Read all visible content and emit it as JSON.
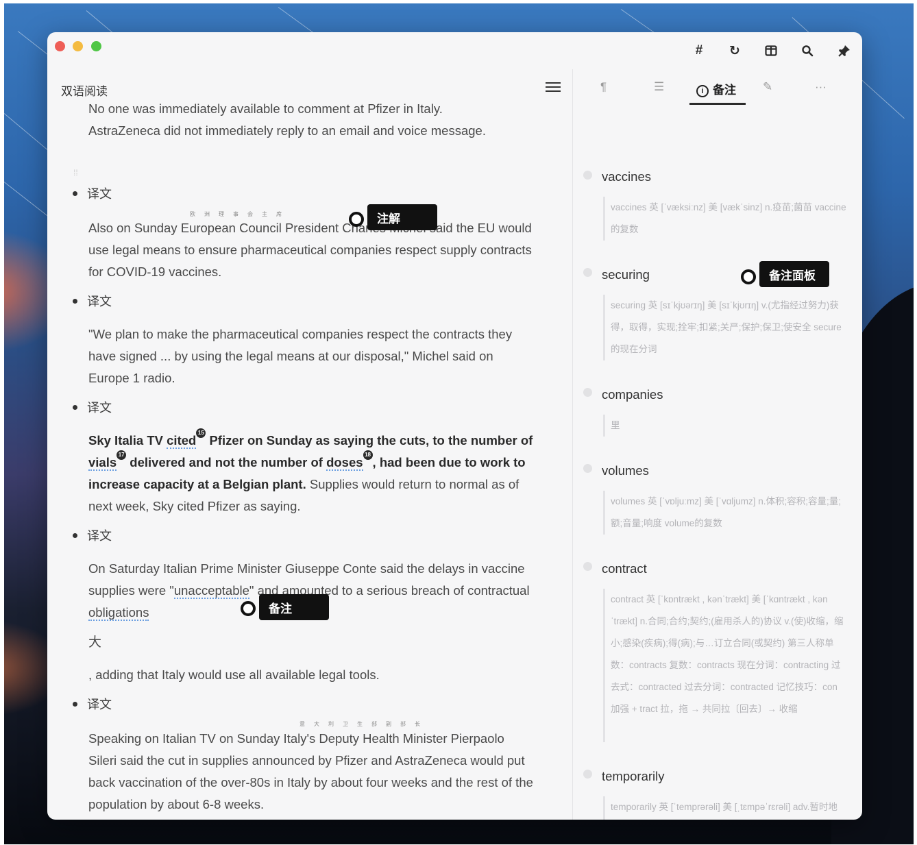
{
  "app": {
    "title": "双语阅读"
  },
  "toolbar": {
    "hash_label": "#",
    "refresh_label": "↻",
    "layout_label": "◫",
    "search_label": "⌕",
    "pin_label": "📌"
  },
  "reader": {
    "para_intro_1": "No one was immediately available to comment at Pfizer in Italy.",
    "para_intro_2": "AstraZeneca did not immediately reply to an email and voice message.",
    "translation_label": "译文",
    "ruby_1": "欧洲理事会主席",
    "ruby_2": "意大利卫生部副部长",
    "para_2": "Also on Sunday European Council President Charles Michel said the EU would use legal means to ensure pharmaceutical companies respect supply contracts for COVID-19 vaccines.",
    "para_3": "\"We plan to make the pharmaceutical companies respect the contracts they have signed ... by using the legal means at our disposal,\" Michel said on Europe 1 radio.",
    "para_4_a": "Sky Italia TV ",
    "para_4_w1": "cited",
    "para_4_n1": "15",
    "para_4_b": " Pfizer on Sunday as saying the cuts, to the number of ",
    "para_4_w2": "vials",
    "para_4_n2": "17",
    "para_4_c": " delivered and not the number of ",
    "para_4_w3": "doses",
    "para_4_n3": "18",
    "para_4_d": ", had been due to work to increase capacity at a Belgian plant.",
    "para_4_e": " Supplies would return to normal as of next week, Sky cited Pfizer as saying.",
    "para_5_a": "On Saturday Italian Prime Minister Giuseppe Conte said the delays in vaccine supplies were \"",
    "para_5_w1": "unacceptable",
    "para_5_b": "\" and amounted to a serious breach of contractual ",
    "para_5_w2": "obligations",
    "note_text": "大",
    "para_6": ", adding that Italy would use all available legal tools.",
    "para_7": "Speaking on Italian TV on Sunday Italy's Deputy Health Minister Pierpaolo Sileri said the cut in supplies announced by Pfizer and AstraZeneca would put back vaccination of the over-80s in Italy by about four weeks and the rest of the population by about 6-8 weeks."
  },
  "callouts": {
    "annotation": "注解",
    "notes_panel": "备注面板",
    "note": "备注"
  },
  "side_tabs": {
    "paragraph_label": "¶",
    "outline_label": "☰",
    "notes_label": "备注",
    "wand_label": "✎",
    "more_label": "···"
  },
  "vocab": [
    {
      "word": "vaccines",
      "def": "vaccines 英 [ˈvæksiːnz] 美 [vækˈsinz] n.疫苗;菌苗 vaccine的复数"
    },
    {
      "word": "securing",
      "def": "securing 英 [sɪˈkjʊərɪŋ] 美 [sɪˈkjʊrɪŋ] v.(尤指经过努力)获得，取得，实现;拴牢;扣紧;关严;保护;保卫;使安全 secure的现在分词"
    },
    {
      "word": "companies",
      "def": "里"
    },
    {
      "word": "volumes",
      "def": "volumes 英 [ˈvɒljuːmz] 美 [ˈvɑljumz] n.体积;容积;容量;量;额;音量;响度 volume的复数"
    },
    {
      "word": "contract",
      "def": "contract 英 [ˈkɒntrækt , kənˈtrækt] 美 [ˈkɑntrækt , kənˈtrækt] n.合同;合约;契约;(雇用杀人的)协议 v.(使)收缩，缩小;感染(疾病);得(病);与…订立合同(或契约) 第三人称单数：contracts 复数：contracts 现在分词：contracting 过去式：contracted 过去分词：contracted 记忆技巧：con 加强 + tract 拉，拖 → 共同拉〔回去〕→ 收缩"
    },
    {
      "word": "temporarily",
      "def": "temporarily 英 [ˈtemprərəli] 美 [ˌtɛmpəˈrɛrəli] adv.暂时地"
    }
  ]
}
